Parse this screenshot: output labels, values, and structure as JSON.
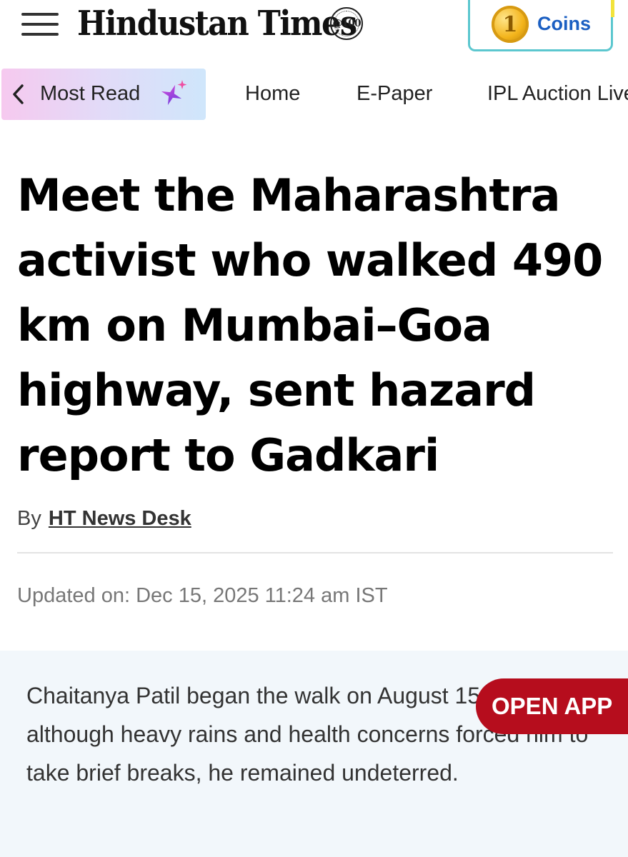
{
  "header": {
    "logo_text": "Hindustan Times",
    "logo_badge": "@100",
    "coins_label": "Coins",
    "coin_digit": "1"
  },
  "nav": {
    "most_read_label": "Most Read",
    "items": [
      {
        "label": "Home"
      },
      {
        "label": "E-Paper"
      },
      {
        "label": "IPL Auction Live"
      }
    ]
  },
  "article": {
    "headline": "Meet the Maharashtra activist who walked 490 km on Mumbai–Goa highway, sent hazard report to Gadkari",
    "byline_prefix": "By",
    "author": "HT News Desk",
    "updated": "Updated on: Dec 15, 2025 11:24 am IST",
    "summary": "Chaitanya Patil began the walk on August 15 in Raigad, although heavy rains and health concerns forced him to take brief breaks, he remained undeterred."
  },
  "open_app_label": "OPEN APP",
  "colors": {
    "coins_border": "#5cc7cf",
    "coins_text": "#1b5fc2",
    "open_app_bg": "#b60d1d",
    "summary_bg": "#f2f7fb"
  }
}
